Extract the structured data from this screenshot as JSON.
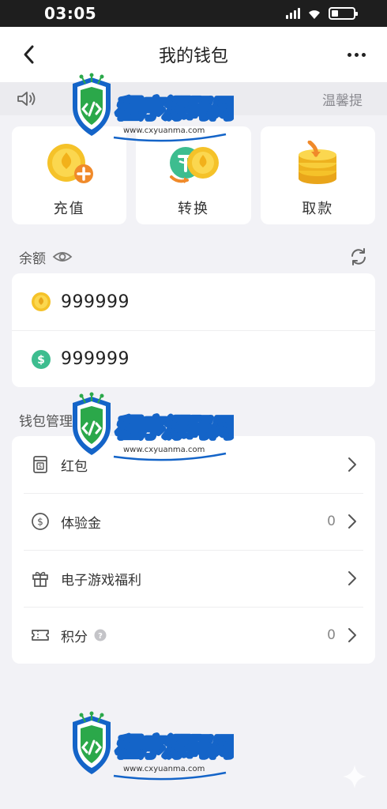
{
  "status_bar": {
    "time": "03:05"
  },
  "navbar": {
    "title": "我的钱包",
    "back_icon": "chevron-left-icon",
    "more_icon": "more-dots-icon"
  },
  "notice": {
    "icon": "speaker-icon",
    "text": "温馨提"
  },
  "actions": [
    {
      "label": "充值",
      "icon": "coin-plus-icon"
    },
    {
      "label": "转换",
      "icon": "coin-exchange-icon"
    },
    {
      "label": "取款",
      "icon": "coin-stack-icon"
    }
  ],
  "balance": {
    "title": "余额",
    "items": [
      {
        "icon": "gold-coin-icon",
        "value": "999999"
      },
      {
        "icon": "dollar-coin-icon",
        "value": "999999"
      }
    ]
  },
  "management": {
    "title": "钱包管理",
    "items": [
      {
        "icon": "red-packet-icon",
        "label": "红包",
        "value": ""
      },
      {
        "icon": "dollar-circle-icon",
        "label": "体验金",
        "value": "0"
      },
      {
        "icon": "gift-icon",
        "label": "电子游戏福利",
        "value": ""
      },
      {
        "icon": "ticket-icon",
        "label": "积分",
        "value": "0"
      }
    ]
  },
  "watermark": {
    "name": "程序源码网",
    "url": "www.cxyuanma.com"
  },
  "colors": {
    "gold": "#f5c229",
    "green": "#3dbd8f",
    "orange": "#f08a2a",
    "watermark_blue": "#1464c8"
  }
}
